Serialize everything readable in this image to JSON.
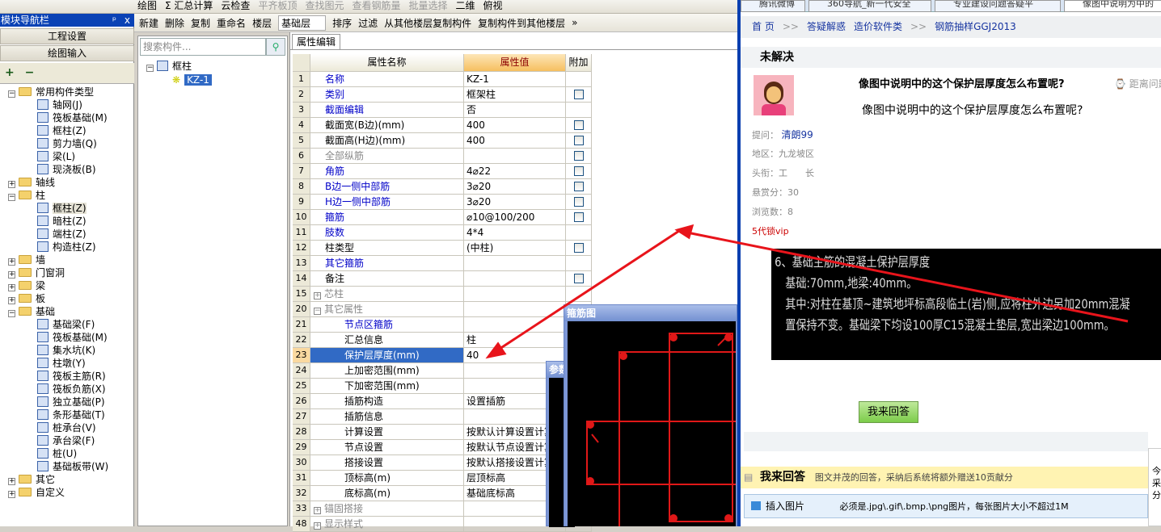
{
  "toolbar1": {
    "items": [
      "绘图",
      "Σ 汇总计算",
      "云检查",
      "平齐板顶",
      "查找图元",
      "查看钢筋量",
      "批量选择",
      "二维",
      "俯视"
    ]
  },
  "toolbar2": {
    "items": [
      "新建",
      "删除",
      "复制",
      "重命名",
      "楼层",
      "基础层",
      "排序",
      "过滤",
      "从其他楼层复制构件",
      "复制构件到其他楼层",
      "»"
    ]
  },
  "nav": {
    "title": "模块导航栏",
    "pin": "ᵖ",
    "close": "x",
    "btn_settings": "工程设置",
    "btn_draw": "绘图输入",
    "expand_all": "+",
    "collapse_all": "−",
    "tree": [
      {
        "label": "常用构件类型",
        "level": 0,
        "folder": true,
        "expanded": true
      },
      {
        "label": "轴网(J)",
        "level": 1
      },
      {
        "label": "筏板基础(M)",
        "level": 1
      },
      {
        "label": "框柱(Z)",
        "level": 1
      },
      {
        "label": "剪力墙(Q)",
        "level": 1
      },
      {
        "label": "梁(L)",
        "level": 1
      },
      {
        "label": "现浇板(B)",
        "level": 1
      },
      {
        "label": "轴线",
        "level": 0,
        "folder": true,
        "expanded": false
      },
      {
        "label": "柱",
        "level": 0,
        "folder": true,
        "expanded": true
      },
      {
        "label": "框柱(Z)",
        "level": 1,
        "selected": true
      },
      {
        "label": "暗柱(Z)",
        "level": 1
      },
      {
        "label": "端柱(Z)",
        "level": 1
      },
      {
        "label": "构造柱(Z)",
        "level": 1
      },
      {
        "label": "墙",
        "level": 0,
        "folder": true,
        "expanded": false
      },
      {
        "label": "门窗洞",
        "level": 0,
        "folder": true,
        "expanded": false
      },
      {
        "label": "梁",
        "level": 0,
        "folder": true,
        "expanded": false
      },
      {
        "label": "板",
        "level": 0,
        "folder": true,
        "expanded": false
      },
      {
        "label": "基础",
        "level": 0,
        "folder": true,
        "expanded": true
      },
      {
        "label": "基础梁(F)",
        "level": 1
      },
      {
        "label": "筏板基础(M)",
        "level": 1
      },
      {
        "label": "集水坑(K)",
        "level": 1
      },
      {
        "label": "柱墩(Y)",
        "level": 1
      },
      {
        "label": "筏板主筋(R)",
        "level": 1
      },
      {
        "label": "筏板负筋(X)",
        "level": 1
      },
      {
        "label": "独立基础(P)",
        "level": 1
      },
      {
        "label": "条形基础(T)",
        "level": 1
      },
      {
        "label": "桩承台(V)",
        "level": 1
      },
      {
        "label": "承台梁(F)",
        "level": 1
      },
      {
        "label": "桩(U)",
        "level": 1
      },
      {
        "label": "基础板带(W)",
        "level": 1
      },
      {
        "label": "其它",
        "level": 0,
        "folder": true,
        "expanded": false
      },
      {
        "label": "自定义",
        "level": 0,
        "folder": true,
        "expanded": false
      }
    ]
  },
  "components": {
    "search_placeholder": "搜索构件...",
    "group": "框柱",
    "item": "KZ-1"
  },
  "props": {
    "tab": "属性编辑",
    "headers": [
      "属性名称",
      "属性值",
      "附加"
    ],
    "rows": [
      {
        "n": "1",
        "name": "名称",
        "val": "KZ-1",
        "c": "blue",
        "cb": false
      },
      {
        "n": "2",
        "name": "类别",
        "val": "框架柱",
        "c": "blue",
        "cb": true
      },
      {
        "n": "3",
        "name": "截面编辑",
        "val": "否",
        "c": "blue",
        "cb": false
      },
      {
        "n": "4",
        "name": "截面宽(B边)(mm)",
        "val": "400",
        "c": "",
        "cb": true
      },
      {
        "n": "5",
        "name": "截面高(H边)(mm)",
        "val": "400",
        "c": "",
        "cb": true
      },
      {
        "n": "6",
        "name": "全部纵筋",
        "val": "",
        "c": "gray",
        "cb": true
      },
      {
        "n": "7",
        "name": "角筋",
        "val": "4⌀22",
        "c": "blue",
        "cb": true
      },
      {
        "n": "8",
        "name": "B边一侧中部筋",
        "val": "3⌀20",
        "c": "blue",
        "cb": true
      },
      {
        "n": "9",
        "name": "H边一侧中部筋",
        "val": "3⌀20",
        "c": "blue",
        "cb": true
      },
      {
        "n": "10",
        "name": "箍筋",
        "val": "⌀10@100/200",
        "c": "blue",
        "cb": true
      },
      {
        "n": "11",
        "name": "肢数",
        "val": "4*4",
        "c": "blue",
        "cb": false
      },
      {
        "n": "12",
        "name": "柱类型",
        "val": "(中柱)",
        "c": "",
        "cb": true
      },
      {
        "n": "13",
        "name": "其它箍筋",
        "val": "",
        "c": "blue",
        "cb": false
      },
      {
        "n": "14",
        "name": "备注",
        "val": "",
        "c": "",
        "cb": true
      },
      {
        "n": "15",
        "name": "芯柱",
        "val": "",
        "c": "gray",
        "group": "+"
      },
      {
        "n": "20",
        "name": "其它属性",
        "val": "",
        "c": "gray",
        "group": "−"
      },
      {
        "n": "21",
        "name": "节点区箍筋",
        "val": "",
        "c": "blue",
        "child": true
      },
      {
        "n": "22",
        "name": "汇总信息",
        "val": "柱",
        "c": "",
        "child": true
      },
      {
        "n": "23",
        "name": "保护层厚度(mm)",
        "val": "40",
        "c": "",
        "child": true,
        "selected": true
      },
      {
        "n": "24",
        "name": "上加密范围(mm)",
        "val": "",
        "c": "",
        "child": true
      },
      {
        "n": "25",
        "name": "下加密范围(mm)",
        "val": "",
        "c": "",
        "child": true
      },
      {
        "n": "26",
        "name": "插筋构造",
        "val": "设置插筋",
        "c": "",
        "child": true
      },
      {
        "n": "27",
        "name": "插筋信息",
        "val": "",
        "c": "",
        "child": true
      },
      {
        "n": "28",
        "name": "计算设置",
        "val": "按默认计算设置计算",
        "c": "",
        "child": true
      },
      {
        "n": "29",
        "name": "节点设置",
        "val": "按默认节点设置计算",
        "c": "",
        "child": true
      },
      {
        "n": "30",
        "name": "搭接设置",
        "val": "按默认搭接设置计算",
        "c": "",
        "child": true
      },
      {
        "n": "31",
        "name": "顶标高(m)",
        "val": "层顶标高",
        "c": "",
        "child": true
      },
      {
        "n": "32",
        "name": "底标高(m)",
        "val": "基础底标高",
        "c": "",
        "child": true
      },
      {
        "n": "33",
        "name": "锚固搭接",
        "val": "",
        "c": "gray",
        "group": "+"
      },
      {
        "n": "48",
        "name": "显示样式",
        "val": "",
        "c": "gray",
        "group": "+"
      }
    ]
  },
  "dialogs": {
    "stirrup_title": "箍筋图",
    "param_title": "参数"
  },
  "browser": {
    "tabs": [
      "腾讯微博",
      "360导航_新一代安全",
      "专业建设问题答疑平",
      "像图中说明为中的"
    ],
    "breadcrumb": [
      "首 页",
      ">>",
      "答疑解惑",
      "造价软件类",
      ">>",
      "钢筋抽样GGJ2013"
    ],
    "status": "未解决",
    "question_title": "像图中说明中的这个保护层厚度怎么布置呢?",
    "distance": "距离问题",
    "question_body": "像图中说明中的这个保护层厚度怎么布置呢?",
    "asker_label": "提问：",
    "asker": "清朗99",
    "region": "地区：九龙坡区",
    "title": "头衔：工　　长",
    "reward": "悬赏分：30",
    "views": "浏览数：8",
    "vip": "5代锁vip",
    "cad_lines": [
      "6、基础主筋的混凝土保护层厚度",
      "　基础:70mm,地梁:40mm。",
      "　其中:对柱在基顶~建筑地坪标高段临土(岩)侧,应将柱外边另加20mm混凝",
      "　置保持不变。基础梁下均设100厚C15混凝土垫层,宽出梁边100mm。"
    ],
    "answer_button": "我来回答",
    "answer_header": "我来回答",
    "answer_hint": "图文并茂的回答，采纳后系统将额外赠送10贡献分",
    "insert_image": "插入图片",
    "image_rule": "必须是.jpg\\.gif\\.bmp.\\png图片，每张图片大小不超过1M",
    "side_text": [
      "今",
      "采",
      "分"
    ]
  },
  "colors": {
    "selection": "#316ac5",
    "annotation_arrow": "#e8141b",
    "nav_title": "#0a42b5",
    "link": "#1634a0"
  }
}
